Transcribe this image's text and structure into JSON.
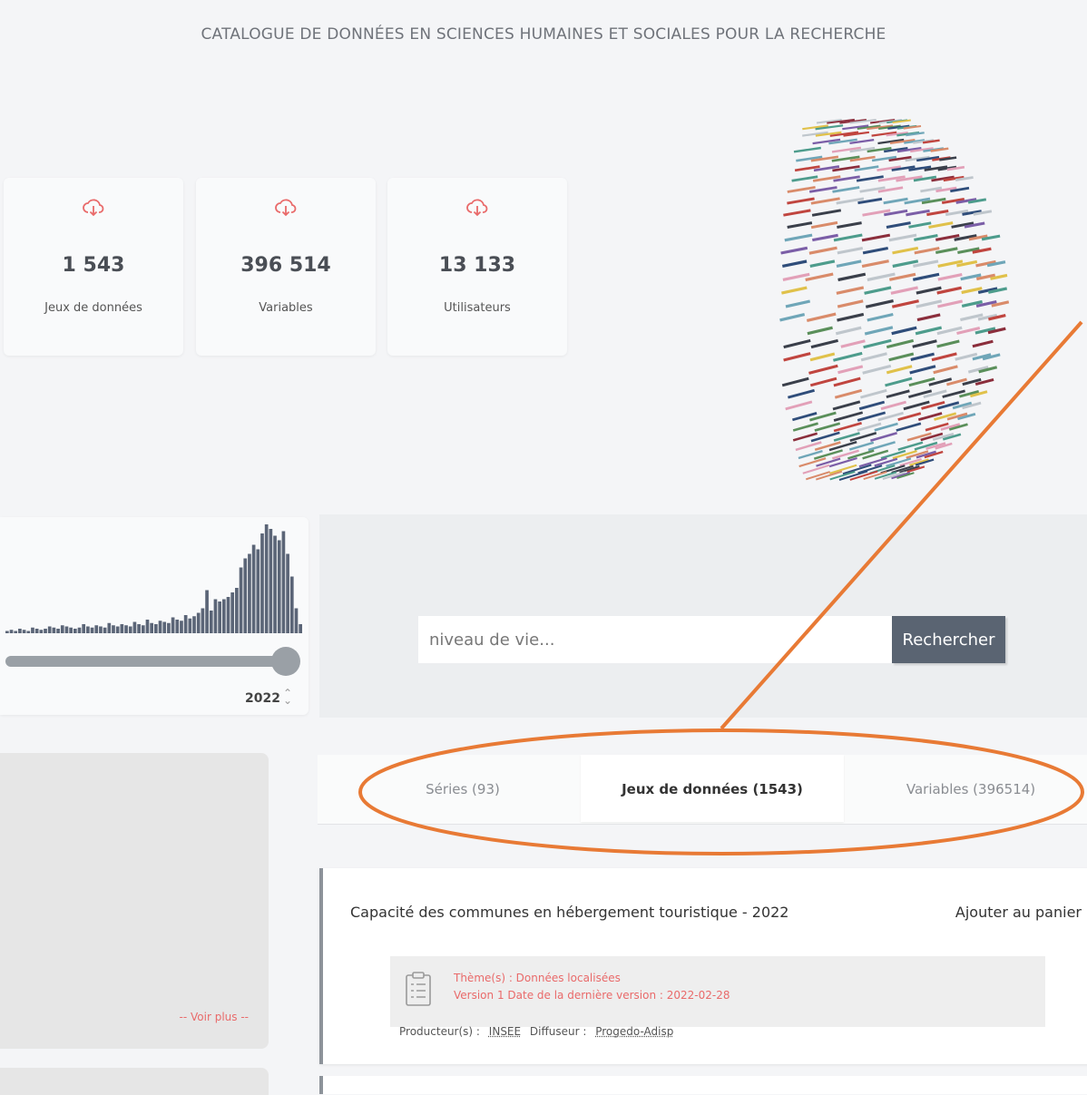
{
  "header": {
    "title": "CATALOGUE DE DONNÉES EN SCIENCES HUMAINES ET SOCIALES POUR LA RECHERCHE"
  },
  "stats": [
    {
      "value": "1 543",
      "label": "Jeux de données",
      "icon": "cloud-download-icon"
    },
    {
      "value": "396 514",
      "label": "Variables",
      "icon": "cloud-download-icon"
    },
    {
      "value": "13 133",
      "label": "Utilisateurs",
      "icon": "cloud-download-icon"
    }
  ],
  "colors": {
    "accent": "#e96a6a",
    "button": "#5a6472",
    "histogram_bar": "#5b6577",
    "annotation": "#e87a35"
  },
  "timeline": {
    "selected_year": "2022",
    "histogram": [
      2,
      3,
      2,
      4,
      3,
      2,
      5,
      4,
      3,
      4,
      6,
      5,
      4,
      7,
      6,
      5,
      4,
      5,
      8,
      6,
      5,
      7,
      6,
      5,
      9,
      7,
      6,
      8,
      7,
      6,
      10,
      8,
      7,
      12,
      9,
      8,
      11,
      10,
      9,
      14,
      12,
      11,
      16,
      13,
      15,
      18,
      22,
      38,
      20,
      30,
      28,
      30,
      32,
      36,
      40,
      58,
      66,
      70,
      78,
      74,
      88,
      96,
      92,
      86,
      82,
      90,
      70,
      50,
      22,
      8
    ]
  },
  "search": {
    "placeholder": "niveau de vie...",
    "button_label": "Rechercher"
  },
  "facets": {
    "voir_plus_label": "-- Voir plus --"
  },
  "tabs": [
    {
      "label": "Séries (93)",
      "active": false
    },
    {
      "label": "Jeux de données (1543)",
      "active": true
    },
    {
      "label": "Variables (396514)",
      "active": false
    }
  ],
  "result": {
    "title": "Capacité des communes en hébergement touristique - 2022",
    "cart_label": "Ajouter au panier",
    "theme_line": "Thème(s) :  Données localisées",
    "version_line": "Version 1 Date de la dernière version : 2022-02-28",
    "producer_label": "Producteur(s) :",
    "producer": "INSEE",
    "distributor_label": "Diffuseur :",
    "distributor": "Progedo-Adisp"
  }
}
